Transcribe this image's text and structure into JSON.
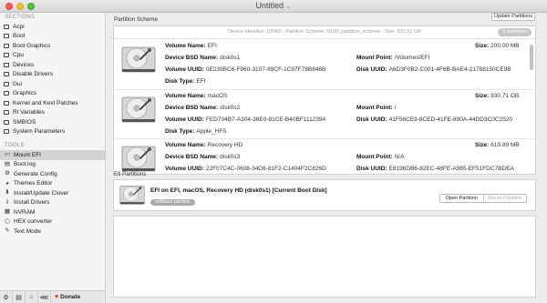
{
  "window": {
    "title": "Untitled"
  },
  "sidebar": {
    "sections_header": "SECTIONS",
    "sections": [
      "Acpi",
      "Boot",
      "Boot Graphics",
      "Cpu",
      "Devices",
      "Disable Drivers",
      "Gui",
      "Graphics",
      "Kernel and Kext Patches",
      "Rt Variables",
      "SMBIOS",
      "System Parameters"
    ],
    "tools_header": "TOOLS",
    "tools": [
      {
        "label": "Mount EFI",
        "icon": "drive-icon",
        "glyph": "▭",
        "selected": true
      },
      {
        "label": "Boot.log",
        "icon": "document-icon",
        "glyph": "▤"
      },
      {
        "label": "Generate Config",
        "icon": "gear-icon",
        "glyph": "⚙"
      },
      {
        "label": "Themes Editor",
        "icon": "palette-icon",
        "glyph": "◕"
      },
      {
        "label": "Install/Update Clover",
        "icon": "download-icon",
        "glyph": "⬇"
      },
      {
        "label": "Install Drivers",
        "icon": "install-icon",
        "glyph": "⇩"
      },
      {
        "label": "NVRAM",
        "icon": "chip-icon",
        "glyph": "▦"
      },
      {
        "label": "HEX converter",
        "icon": "hex-icon",
        "glyph": "⬡"
      },
      {
        "label": "Text Mode",
        "icon": "text-icon",
        "glyph": "✎"
      }
    ]
  },
  "bottom_bar": {
    "donate": "Donate"
  },
  "partition_scheme": {
    "label": "Partition Scheme",
    "update_button": "Update Partitions",
    "descriptor": "Device Identifier: DISK0 - Partition Scheme: GUID_partition_scheme - Size: 931.51 GB",
    "count_badge": "3 partitions",
    "labels": {
      "volume_name": "Volume Name:",
      "bsd_name": "Device BSD Name:",
      "volume_uuid": "Volume UUID:",
      "disk_type": "Disk Type:",
      "size": "Size:",
      "mount_point": "Mount Point:",
      "disk_uuid": "Disk UUID:"
    },
    "partitions": [
      {
        "volume_name": "EFI",
        "bsd_name": "disk0s1",
        "volume_uuid": "0E239BC6-F960-3107-89CF-1C97F78B846B",
        "disk_type": "EFI",
        "size": "200.00 MB",
        "mount_point": "/Volumes/EFI",
        "disk_uuid": "A6D3F0B2-C001-4F6B-BAE4-21788150CE9B"
      },
      {
        "volume_name": "macOS",
        "bsd_name": "disk0s2",
        "volume_uuid": "FED704B7-A304-38E0-81CE-B40BF1112394",
        "disk_type": "Apple_HFS",
        "size": "930.71 GB",
        "mount_point": "/",
        "disk_uuid": "41F56CE9-8CED-41FE-890A-44DD3C0C2520"
      },
      {
        "volume_name": "Recovery HD",
        "bsd_name": "disk0s3",
        "volume_uuid": "22F07C4C-0608-34D8-81F2-C1404F2C826D",
        "disk_type": "",
        "size": "619.89 MB",
        "mount_point": "N/A",
        "disk_uuid": "E8196DB6-82EC-48FE-A985-EF51FDC7BDEA"
      }
    ]
  },
  "efi_partitions": {
    "label": "Efi Partitions",
    "entry_title": "EFI on EFI, macOS, Recovery HD (disk0s1) [Current Boot Disk]",
    "status_pill": "unMount partition",
    "open_button": "Open Partition",
    "mount_button": "Mount Partition"
  }
}
